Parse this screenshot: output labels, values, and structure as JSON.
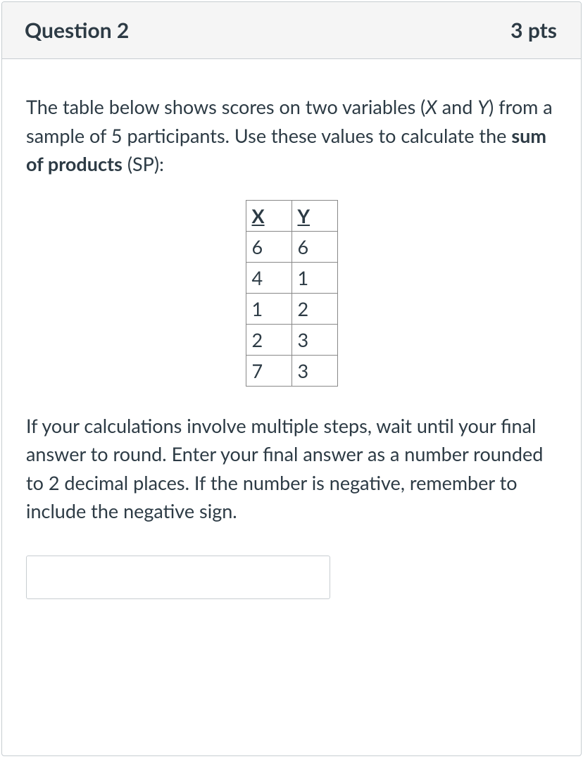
{
  "header": {
    "title": "Question 2",
    "points": "3 pts"
  },
  "body": {
    "intro_part1": "The table below shows scores on two variables (",
    "intro_x": "X",
    "intro_and": " and ",
    "intro_y": "Y",
    "intro_part2": ") from a sample of 5 participants. Use these values to calculate the ",
    "intro_bold": "sum of products",
    "intro_part3": " (SP):",
    "table": {
      "headers": [
        "X",
        "Y"
      ],
      "rows": [
        [
          "6",
          "6"
        ],
        [
          "4",
          "1"
        ],
        [
          "1",
          "2"
        ],
        [
          "2",
          "3"
        ],
        [
          "7",
          "3"
        ]
      ]
    },
    "instruction": "If your calculations involve multiple steps, wait until your final answer to round. Enter your final answer as a number rounded to 2 decimal places. If the number is negative, remember to include the negative sign.",
    "answer_value": ""
  }
}
